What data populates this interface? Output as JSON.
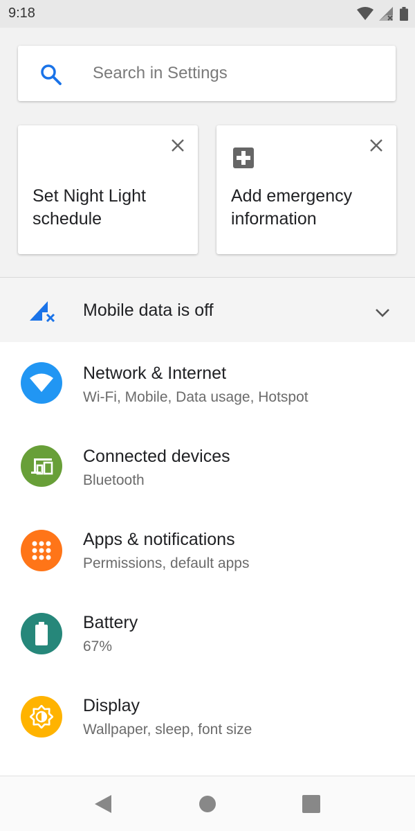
{
  "status_bar": {
    "time": "9:18",
    "icons": [
      "wifi-icon",
      "cell-signal-off-icon",
      "battery-icon"
    ]
  },
  "search": {
    "placeholder": "Search in Settings",
    "icon": "search-icon",
    "accent_color": "#1a73e8"
  },
  "suggestions": [
    {
      "icon": "moon-icon",
      "text": "Set Night Light schedule"
    },
    {
      "icon": "medical-plus-icon",
      "text": "Add emergency information"
    }
  ],
  "condition": {
    "icon": "mobile-data-off-icon",
    "text": "Mobile data is off",
    "icon_color": "#1a73e8"
  },
  "settings": [
    {
      "icon": "wifi-icon",
      "title": "Network & Internet",
      "subtitle": "Wi-Fi, Mobile, Data usage, Hotspot",
      "color": "#2196f3"
    },
    {
      "icon": "devices-icon",
      "title": "Connected devices",
      "subtitle": "Bluetooth",
      "color": "#689f38"
    },
    {
      "icon": "apps-grid-icon",
      "title": "Apps & notifications",
      "subtitle": "Permissions, default apps",
      "color": "#ff7518"
    },
    {
      "icon": "battery-icon",
      "title": "Battery",
      "subtitle": "67%",
      "color": "#26877a"
    },
    {
      "icon": "brightness-icon",
      "title": "Display",
      "subtitle": "Wallpaper, sleep, font size",
      "color": "#ffb300"
    }
  ],
  "nav_bar": {
    "buttons": [
      "back-icon",
      "home-icon",
      "recents-icon"
    ]
  }
}
